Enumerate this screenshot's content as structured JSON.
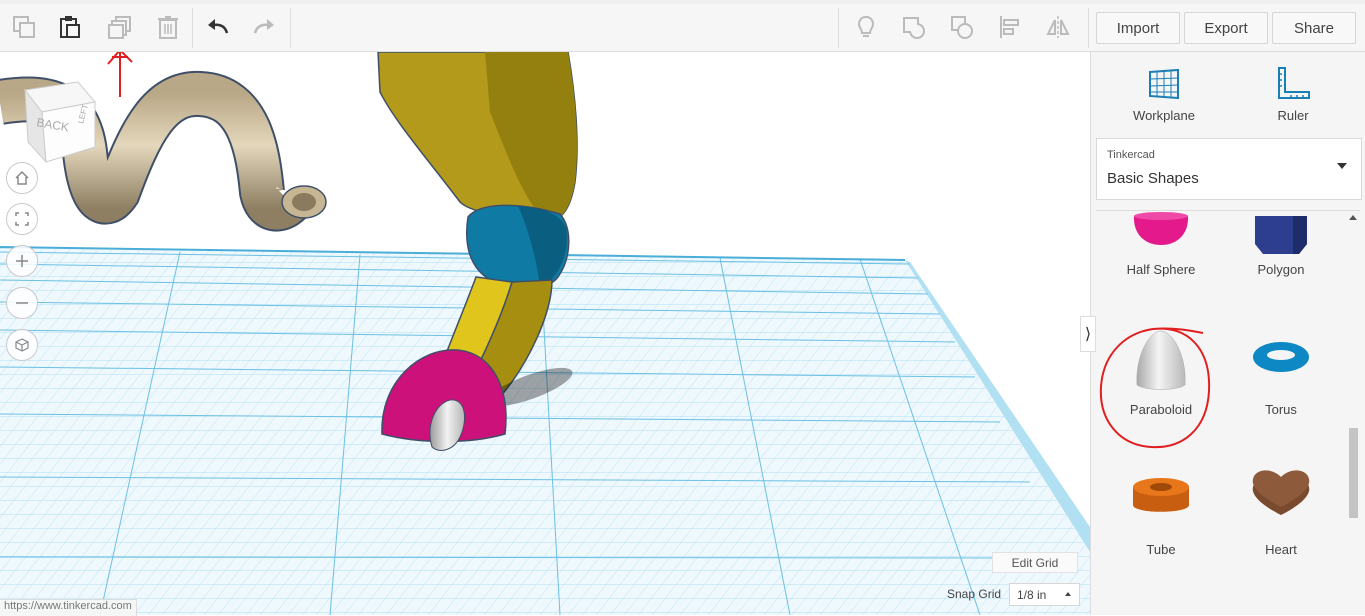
{
  "toolbar": {
    "icons": [
      "copy-icon",
      "paste-icon",
      "duplicate-icon",
      "delete-icon",
      "undo-icon",
      "redo-icon",
      "lightbulb-icon",
      "group-icon",
      "ungroup-icon",
      "align-icon",
      "mirror-icon"
    ],
    "import_label": "Import",
    "export_label": "Export",
    "share_label": "Share"
  },
  "viewcube": {
    "face_back": "BACK",
    "face_left": "LEFT"
  },
  "nav": {
    "icons": [
      "home-icon",
      "fit-icon",
      "zoom-in-icon",
      "zoom-out-icon",
      "perspective-icon"
    ]
  },
  "panel": {
    "tools": [
      {
        "label": "Workplane",
        "icon": "workplane-icon"
      },
      {
        "label": "Ruler",
        "icon": "ruler-icon"
      }
    ],
    "library_small": "Tinkercad",
    "library_main": "Basic Shapes",
    "shapes": [
      {
        "label": "Half Sphere",
        "color": "#e3198c"
      },
      {
        "label": "Polygon",
        "color": "#2d3e8f"
      },
      {
        "label": "Paraboloid",
        "color": "#d9d9d9"
      },
      {
        "label": "Torus",
        "color": "#0e88c5"
      },
      {
        "label": "Tube",
        "color": "#e8761b"
      },
      {
        "label": "Heart",
        "color": "#8d5a3b"
      }
    ]
  },
  "grid": {
    "edit_label": "Edit Grid",
    "snap_label": "Snap Grid",
    "snap_value": "1/8 in"
  },
  "status": {
    "url": "https://www.tinkercad.com"
  },
  "colors": {
    "grid_line": "#8fd1ec",
    "tube_shape": "#c9b89a",
    "leg_yellow": "#b39a1a",
    "joint_blue": "#0f7aa3",
    "foot_magenta": "#cc117a",
    "annotation_red": "#e02020"
  }
}
